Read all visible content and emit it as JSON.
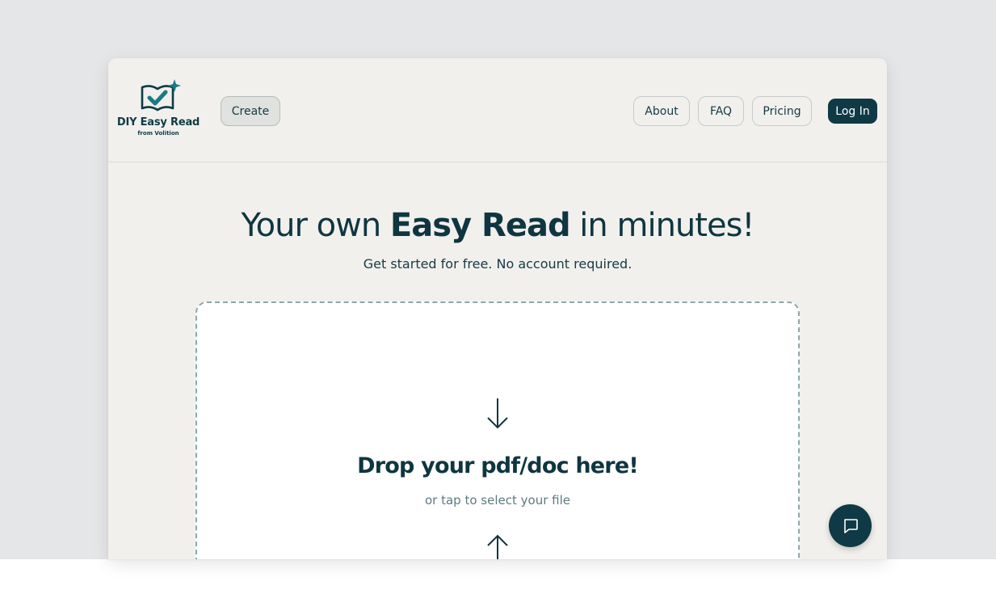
{
  "brand": {
    "name": "DIY Easy Read",
    "tagline": "from Volition",
    "colors": {
      "primary": "#0f3a45",
      "accent": "#1b7a82",
      "page_background": "#f1f0ed"
    }
  },
  "nav": {
    "create_label": "Create",
    "about_label": "About",
    "faq_label": "FAQ",
    "pricing_label": "Pricing",
    "login_label": "Log In"
  },
  "hero": {
    "title_prefix": "Your own ",
    "title_bold": "Easy Read",
    "title_suffix": " in minutes!",
    "subtitle": "Get started for free. No account required."
  },
  "dropzone": {
    "title": "Drop your pdf/doc here!",
    "subtitle": "or tap to select your file",
    "down_icon": "arrow-down-icon",
    "up_icon": "arrow-up-icon"
  },
  "chat": {
    "icon": "chat-bubble-icon"
  }
}
